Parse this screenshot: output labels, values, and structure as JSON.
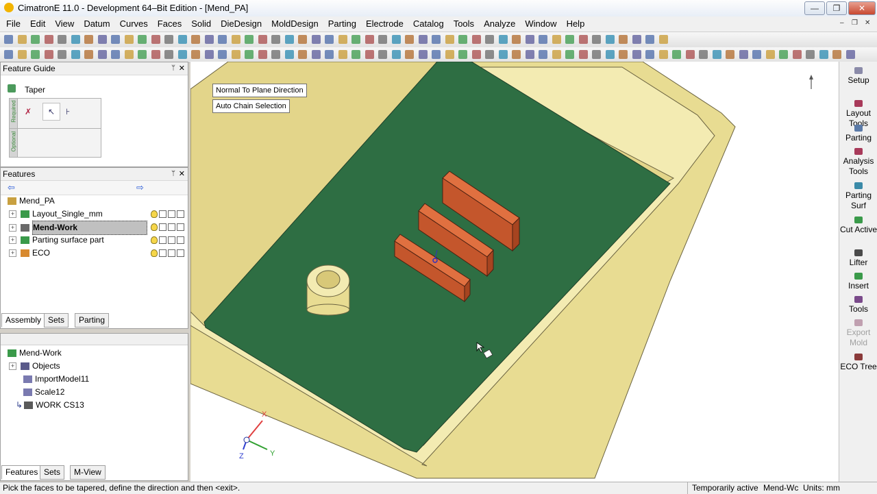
{
  "window": {
    "title": "CimatronE 11.0 - Development 64–Bit Edition - [Mend_PA]",
    "min_glyph": "—",
    "restore_glyph": "❐",
    "close_glyph": "✕"
  },
  "menu": {
    "items": [
      "File",
      "Edit",
      "View",
      "Datum",
      "Curves",
      "Faces",
      "Solid",
      "DieDesign",
      "MoldDesign",
      "Parting",
      "Electrode",
      "Catalog",
      "Tools",
      "Analyze",
      "Window",
      "Help"
    ],
    "mdi_min": "‒",
    "mdi_restore": "❐",
    "mdi_close": "✕"
  },
  "feature_guide": {
    "header": "Feature Guide",
    "title": "Taper",
    "required_label": "Required",
    "optional_label": "Optional"
  },
  "features_panel": {
    "header": "Features",
    "root": "Mend_PA",
    "items": [
      "Layout_Single_mm",
      "Mend-Work",
      "Parting surface part",
      "ECO"
    ],
    "tabs": [
      "Assembly",
      "Sets",
      "Parting"
    ]
  },
  "lower_tree": {
    "root": "Mend-Work",
    "items": [
      "Objects",
      "ImportModel11",
      "Scale12",
      "WORK CS13"
    ],
    "tabs": [
      "Features",
      "Sets",
      "M-View"
    ]
  },
  "viewport": {
    "buttons": [
      "Normal To Plane Direction",
      "Auto Chain Selection"
    ],
    "axis_labels": {
      "x": "X",
      "y": "Y",
      "z": "Z"
    }
  },
  "right_panel": {
    "items": [
      {
        "label": "Setup",
        "icon": "setup-icon",
        "disabled": false
      },
      {
        "label": "Layout Tools",
        "icon": "layout-tools-icon",
        "disabled": false
      },
      {
        "label": "Parting",
        "icon": "parting-icon",
        "disabled": false
      },
      {
        "label": "Analysis Tools",
        "icon": "analysis-tools-icon",
        "disabled": false
      },
      {
        "label": "Parting Surf",
        "icon": "parting-surf-icon",
        "disabled": false
      },
      {
        "label": "Cut Active",
        "icon": "cut-active-icon",
        "disabled": false
      },
      {
        "label": "Lifter",
        "icon": "lifter-icon",
        "disabled": false
      },
      {
        "label": "Insert",
        "icon": "insert-icon",
        "disabled": false
      },
      {
        "label": "Tools",
        "icon": "tools-icon",
        "disabled": false
      },
      {
        "label": "Export Mold",
        "icon": "export-mold-icon",
        "disabled": true
      },
      {
        "label": "ECO Tree",
        "icon": "eco-tree-icon",
        "disabled": false
      }
    ]
  },
  "status": {
    "prompt": "Pick the faces to be tapered, define the direction and then <exit>.",
    "mode": "Temporarily active",
    "active_part": "Mend-Wc",
    "units": "Units: mm"
  },
  "colors": {
    "floor_green": "#2e6e43",
    "shell_yellow": "#e8dc92",
    "rib_orange": "#c4562c"
  }
}
